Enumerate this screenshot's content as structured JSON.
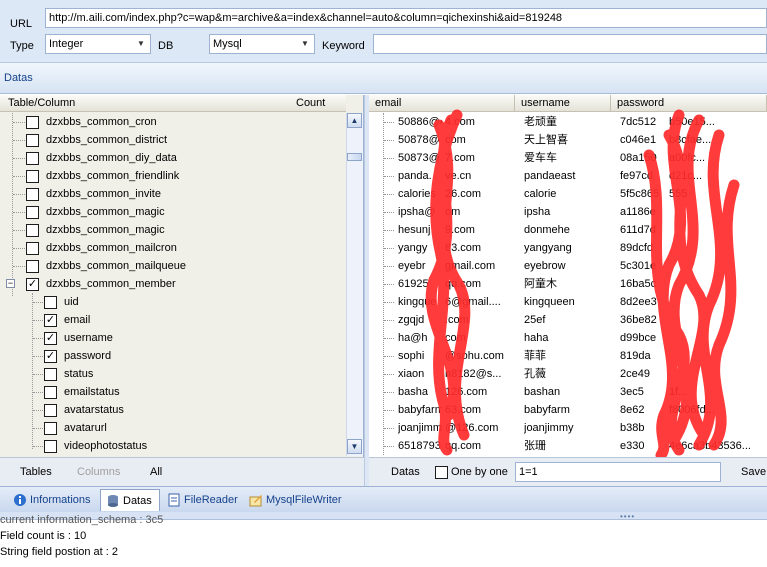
{
  "form": {
    "url_label": "URL",
    "url_value": "http://m.aili.com/index.php?c=wap&m=archive&a=index&channel=auto&column=qichexinshi&aid=819248",
    "type_label": "Type",
    "type_value": "Integer",
    "db_label": "DB",
    "db_value": "Mysql",
    "keyword_label": "Keyword",
    "keyword_value": ""
  },
  "datas_header": "Datas",
  "left_panel": {
    "col_table": "Table/Column",
    "col_count": "Count",
    "tables": [
      {
        "name": "dzxbbs_common_cron",
        "checked": false
      },
      {
        "name": "dzxbbs_common_district",
        "checked": false
      },
      {
        "name": "dzxbbs_common_diy_data",
        "checked": false
      },
      {
        "name": "dzxbbs_common_friendlink",
        "checked": false
      },
      {
        "name": "dzxbbs_common_invite",
        "checked": false
      },
      {
        "name": "dzxbbs_common_magic",
        "checked": false
      },
      {
        "name": "dzxbbs_common_magic",
        "checked": false
      },
      {
        "name": "dzxbbs_common_mailcron",
        "checked": false
      },
      {
        "name": "dzxbbs_common_mailqueue",
        "checked": false
      },
      {
        "name": "dzxbbs_common_member",
        "checked": true
      }
    ],
    "columns": [
      {
        "name": "uid",
        "checked": false
      },
      {
        "name": "email",
        "checked": true
      },
      {
        "name": "username",
        "checked": true
      },
      {
        "name": "password",
        "checked": true
      },
      {
        "name": "status",
        "checked": false
      },
      {
        "name": "emailstatus",
        "checked": false
      },
      {
        "name": "avatarstatus",
        "checked": false
      },
      {
        "name": "avatarurl",
        "checked": false
      },
      {
        "name": "videophotostatus",
        "checked": false
      }
    ],
    "footer": {
      "tables": "Tables",
      "columns": "Columns",
      "all": "All"
    }
  },
  "grid": {
    "headers": {
      "email": "email",
      "username": "username",
      "password": "password"
    },
    "rows": [
      {
        "email": "50886@40",
        "email2": "4.com",
        "username": "老顽童",
        "password": "7dc512",
        "password2": "b50e15..."
      },
      {
        "email": "50878@",
        "email2": "com",
        "username": "天上智喜",
        "password": "c046e1",
        "password2": "b8cfae..."
      },
      {
        "email": "50873@",
        "email2": "7.com",
        "username": "爱车车",
        "password": "08a150",
        "password2": "a00fc..."
      },
      {
        "email": "panda.",
        "email2": "ve.cn",
        "username": "pandaeast",
        "password": "fe97cd",
        "password2": "d21c..."
      },
      {
        "email": "calories",
        "email2": "26.com",
        "username": "calorie",
        "password": "5f5c865",
        "password2": "555"
      },
      {
        "email": "ipsha@",
        "email2": "om",
        "username": "ipsha",
        "password": "a1186e",
        "password2": ""
      },
      {
        "email": "hesunj",
        "email2": "9.com",
        "username": "donmehe",
        "password": "611d7d",
        "password2": ""
      },
      {
        "email": "yangy",
        "email2": "63.com",
        "username": "yangyang",
        "password": "89dcfd",
        "password2": ""
      },
      {
        "email": "eyebr",
        "email2": "gmail.com",
        "username": "eyebrow",
        "password": "5c301e",
        "password2": ""
      },
      {
        "email": "61925",
        "email2": "qq.com",
        "username": "阿童木",
        "password": "16ba5c",
        "password2": ""
      },
      {
        "email": "kingque",
        "email2": "6@gmail....",
        "username": "kingqueen",
        "password": "8d2ee3",
        "password2": ""
      },
      {
        "email": "zgqjd",
        "email2": ".com",
        "username": "25ef",
        "password": "36be82",
        "password2": ""
      },
      {
        "email": "ha@h",
        "email2": "com",
        "username": "haha",
        "password": "d99bce",
        "password2": ""
      },
      {
        "email": "sophi",
        "email2": "@sohu.com",
        "username": "菲菲",
        "password": "819da",
        "password2": ""
      },
      {
        "email": "xiaon",
        "email2": "n8182@s...",
        "username": "孔薇",
        "password": "2ce49",
        "password2": ""
      },
      {
        "email": "basha",
        "email2": "126.com",
        "username": "bashan",
        "password": "3ec5",
        "password2": "1f..."
      },
      {
        "email": "babyfarm",
        "email2": "63.com",
        "username": "babyfarm",
        "password": "8e62",
        "password2": "f8006fd..."
      },
      {
        "email": "joanjimmy",
        "email2": "@126.com",
        "username": "joanjimmy",
        "password": "b38b",
        "password2": ""
      },
      {
        "email": "6518793",
        "email2": "qq.com",
        "username": "张珊",
        "password": "e330",
        "password2": "4e6ca3b43536..."
      }
    ],
    "footer": {
      "datas": "Datas",
      "one_by_one": "One by one",
      "input": "1=1",
      "save": "Save"
    }
  },
  "tabs": [
    {
      "label": "Informations",
      "icon": "info-icon",
      "active": false
    },
    {
      "label": "Datas",
      "icon": "database-icon",
      "active": true
    },
    {
      "label": "FileReader",
      "icon": "file-icon",
      "active": false
    },
    {
      "label": "MysqlFileWriter",
      "icon": "pencil-icon",
      "active": false
    }
  ],
  "log": {
    "partial": "current information_schema : 3c5",
    "field_count": "Field count is : 10",
    "string_field": "String field postion at : 2"
  },
  "colors": {
    "redaction": "#ff2a2a",
    "accent": "#15428b"
  }
}
